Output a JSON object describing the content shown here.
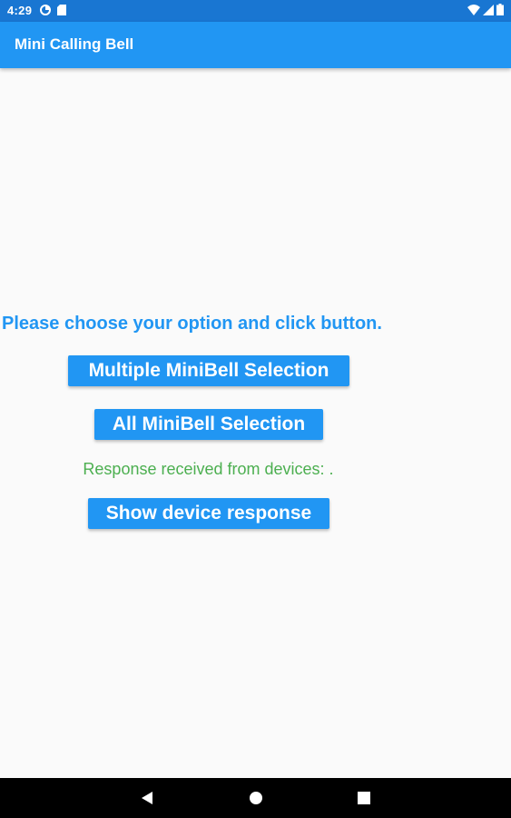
{
  "status_bar": {
    "time": "4:29",
    "left_icons": [
      "data-saver-icon",
      "sd-card-icon"
    ],
    "right_icons": [
      "wifi-icon",
      "signal-icon",
      "battery-icon"
    ]
  },
  "app_bar": {
    "title": "Mini Calling Bell"
  },
  "main": {
    "prompt": "Please choose your option and click button.",
    "multiple_button_label": "Multiple MiniBell Selection",
    "all_button_label": "All MiniBell Selection",
    "response_text": "Response received from devices: .",
    "show_response_button_label": "Show device response"
  },
  "nav_bar": {
    "buttons": [
      "back-icon",
      "home-icon",
      "recents-icon"
    ]
  },
  "colors": {
    "status_bar": "#1976d2",
    "app_bar": "#2196f3",
    "accent": "#2196f3",
    "response_text": "#4caf50",
    "background": "#fafafa",
    "nav_bar": "#000000"
  }
}
